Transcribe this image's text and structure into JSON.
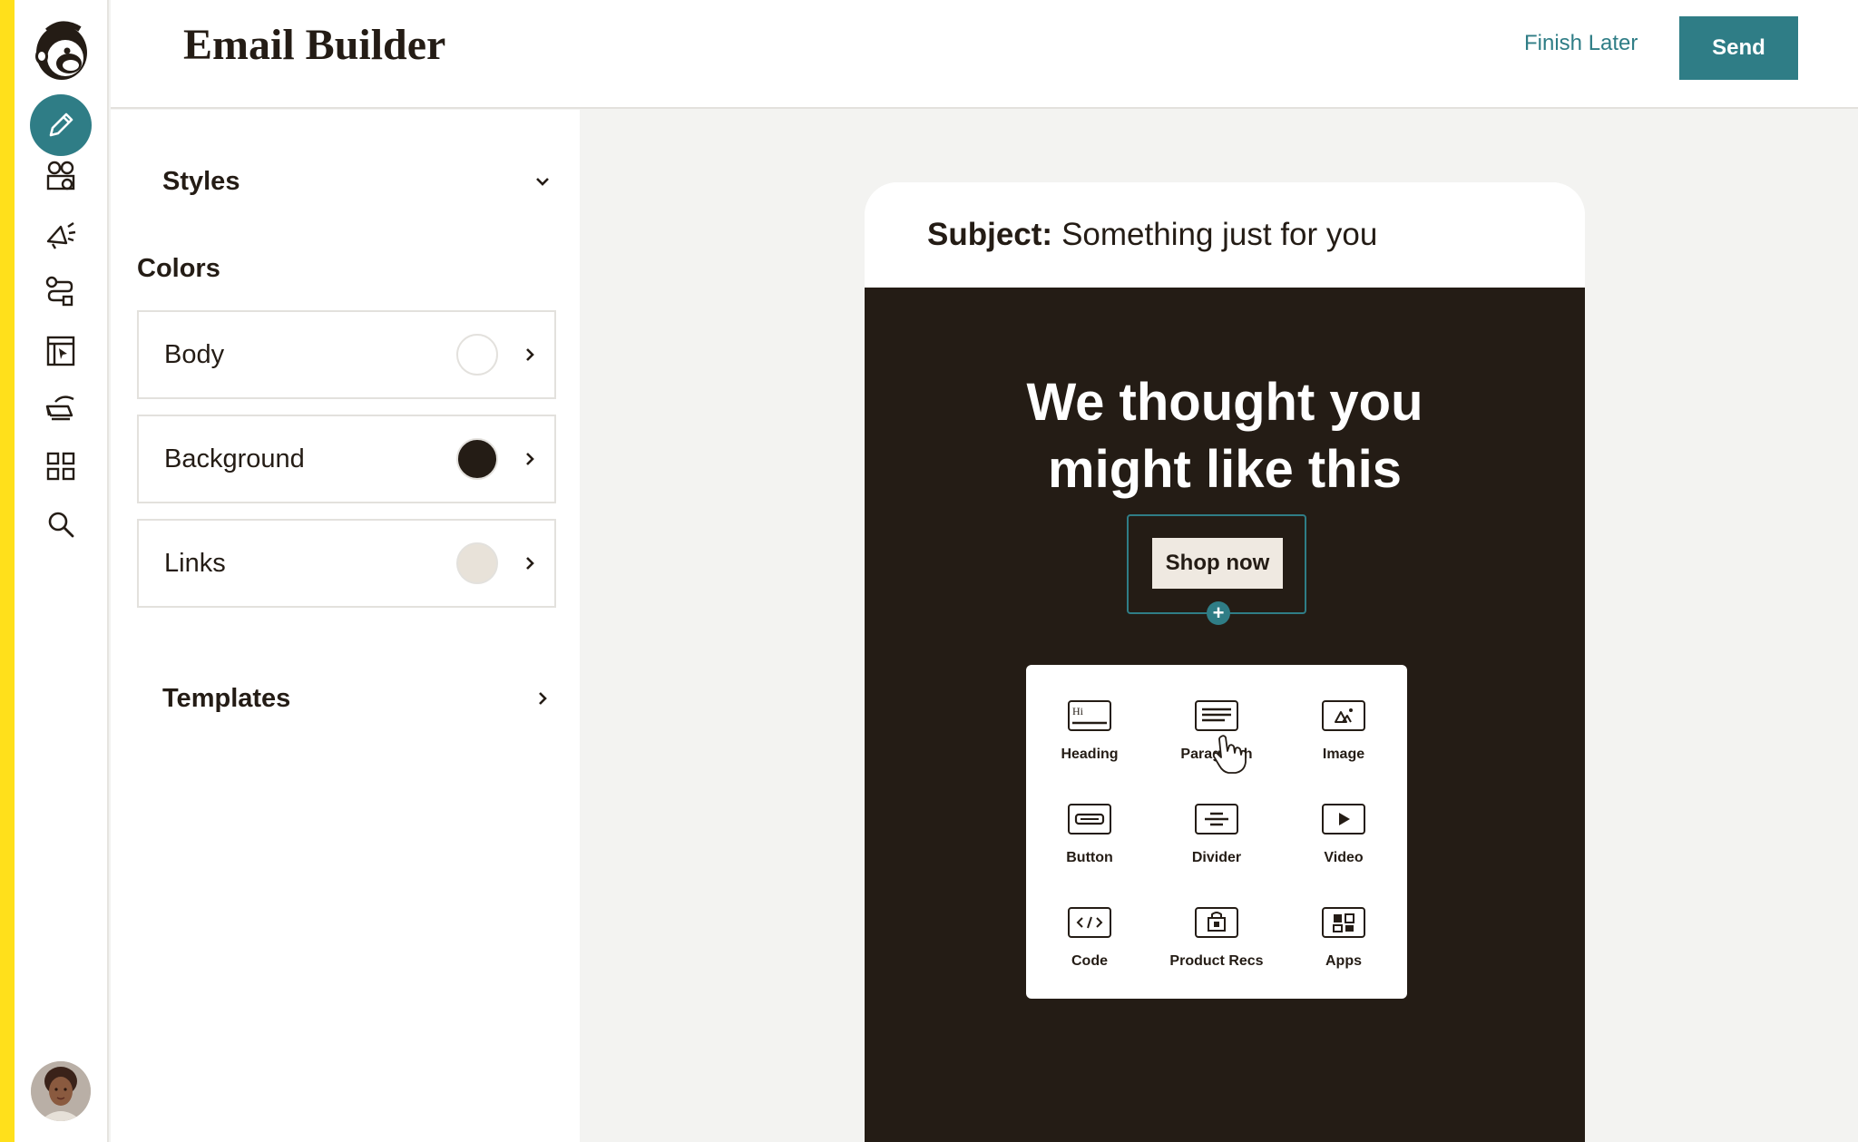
{
  "app": {
    "title": "Email Builder",
    "finish_later": "Finish Later",
    "send": "Send"
  },
  "nav": {
    "items": [
      {
        "icon": "pencil-icon",
        "active": true
      },
      {
        "icon": "audience-icon",
        "active": false
      },
      {
        "icon": "campaigns-megaphone-icon",
        "active": false
      },
      {
        "icon": "automations-icon",
        "active": false
      },
      {
        "icon": "website-icon",
        "active": false
      },
      {
        "icon": "content-studio-icon",
        "active": false
      },
      {
        "icon": "integrations-grid-icon",
        "active": false
      },
      {
        "icon": "search-icon",
        "active": false
      }
    ]
  },
  "panel": {
    "styles_label": "Styles",
    "colors_label": "Colors",
    "colors": [
      {
        "name": "Body",
        "swatch": "#ffffff"
      },
      {
        "name": "Background",
        "swatch": "#241c15"
      },
      {
        "name": "Links",
        "swatch": "#e8e2d9"
      }
    ],
    "templates_label": "Templates"
  },
  "email": {
    "subject_key": "Subject:",
    "subject_value": "Something just for you",
    "headline_line1": "We thought you",
    "headline_line2": "might like this",
    "cta_label": "Shop now"
  },
  "blocks": [
    {
      "label": "Heading",
      "icon": "heading-icon"
    },
    {
      "label": "Paragraph",
      "icon": "paragraph-icon"
    },
    {
      "label": "Image",
      "icon": "image-icon"
    },
    {
      "label": "Button",
      "icon": "button-icon"
    },
    {
      "label": "Divider",
      "icon": "divider-icon"
    },
    {
      "label": "Video",
      "icon": "video-icon"
    },
    {
      "label": "Code",
      "icon": "code-icon"
    },
    {
      "label": "Product Recs",
      "icon": "product-recs-icon"
    },
    {
      "label": "Apps",
      "icon": "apps-icon"
    }
  ],
  "colors": {
    "accent": "#2f7d86",
    "dark": "#241c15",
    "brand_yellow": "#ffe01b"
  }
}
